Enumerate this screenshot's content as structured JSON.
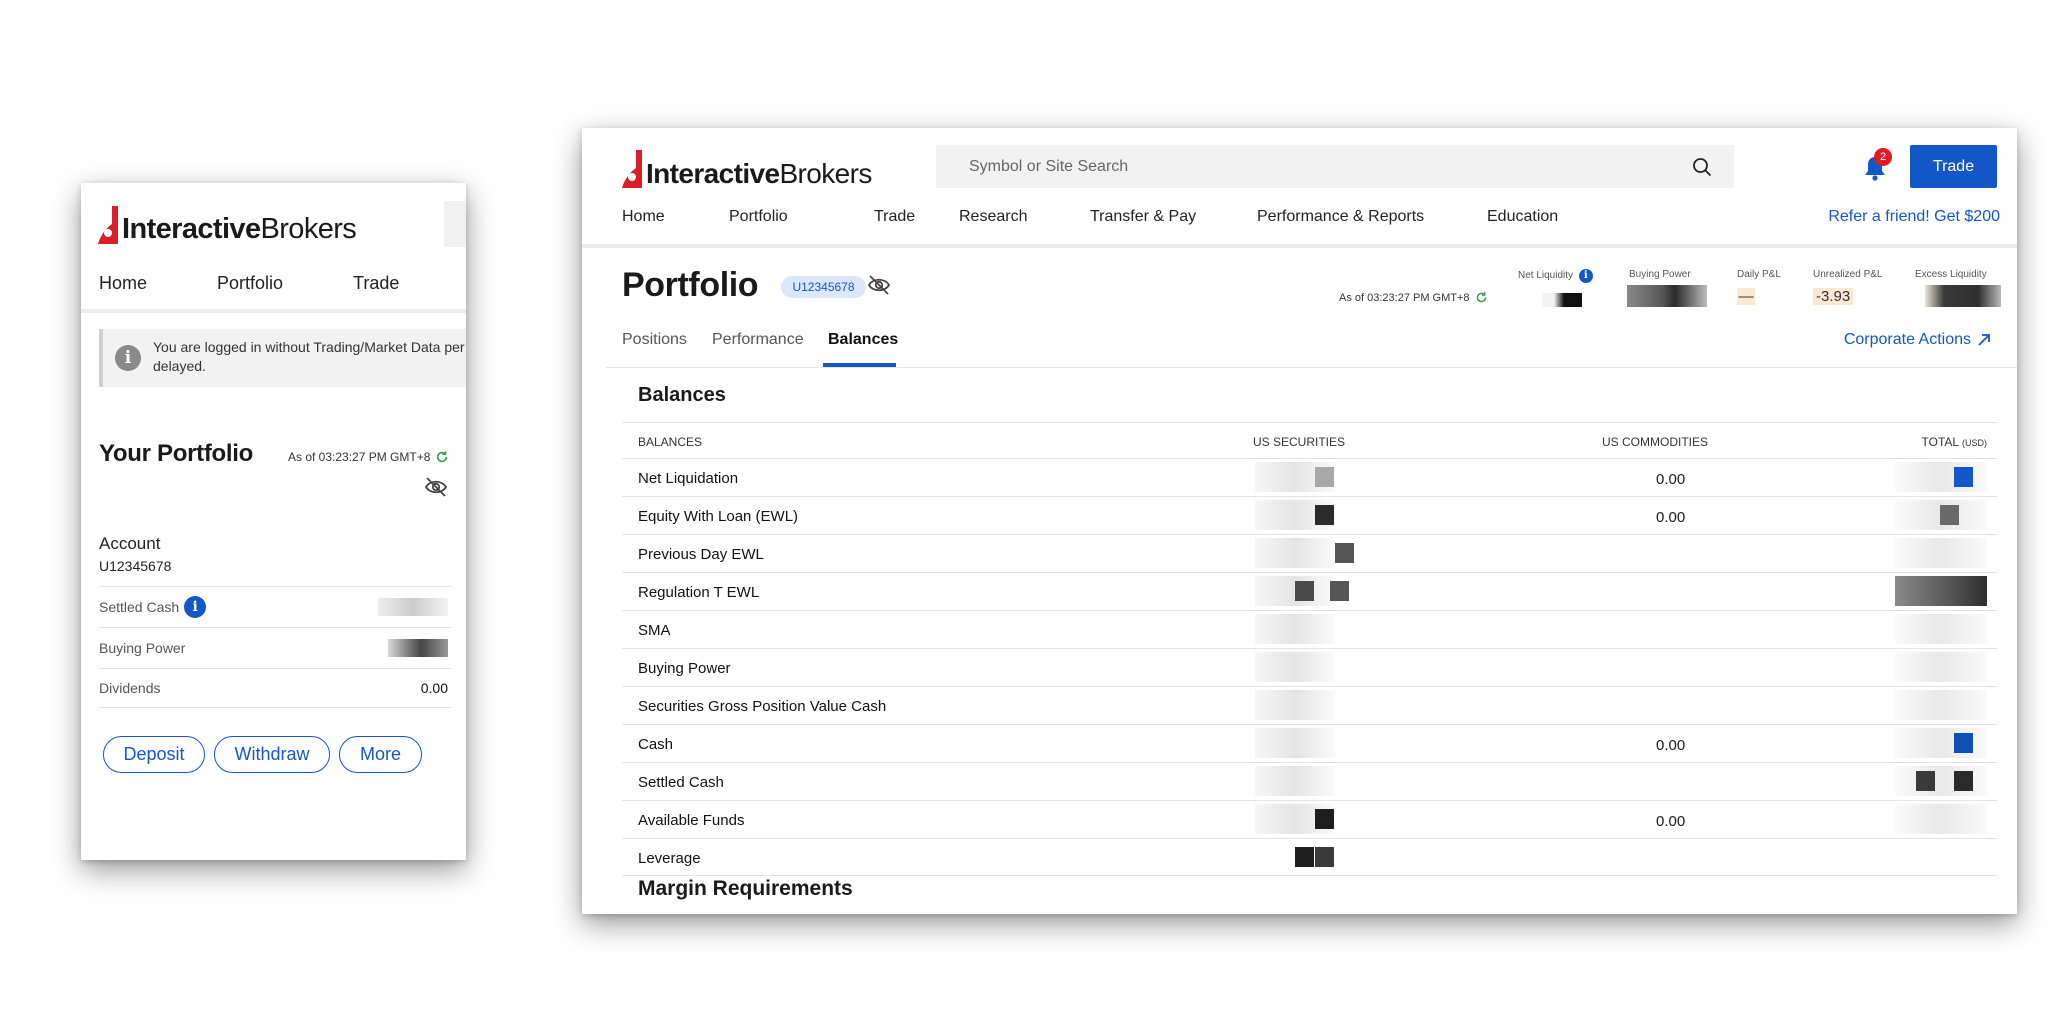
{
  "brand": {
    "bold": "Interactive",
    "regular": "Brokers",
    "color": "#d81e27"
  },
  "accent": "#1457c8",
  "mobile": {
    "nav": [
      "Home",
      "Portfolio",
      "Trade"
    ],
    "notice": "You are logged in without Trading/Market Data per… delayed.",
    "notice_line1": "You are logged in without Trading/Market Data per",
    "notice_line2": "delayed.",
    "title": "Your Portfolio",
    "as_of": "As of 03:23:27 PM GMT+8",
    "account_label": "Account",
    "account_id": "U12345678",
    "rows": [
      {
        "label": "Settled Cash",
        "value": ""
      },
      {
        "label": "Buying Power",
        "value": ""
      },
      {
        "label": "Dividends",
        "value": "0.00"
      }
    ],
    "buttons": [
      "Deposit",
      "Withdraw",
      "More"
    ]
  },
  "desktop": {
    "search_placeholder": "Symbol or Site Search",
    "notification_count": "2",
    "trade_label": "Trade",
    "nav": [
      "Home",
      "Portfolio",
      "Trade",
      "Research",
      "Transfer & Pay",
      "Performance & Reports",
      "Education"
    ],
    "refer": "Refer a friend! Get $200",
    "title": "Portfolio",
    "account_id": "U12345678",
    "as_of": "As of 03:23:27 PM GMT+8",
    "metrics": {
      "net_liquidity": "Net Liquidity",
      "buying_power": "Buying Power",
      "daily_pnl": "Daily P&L",
      "daily_pnl_value": "—",
      "unrealized_pnl": "Unrealized P&L",
      "unrealized_pnl_value": "-3.93",
      "excess_liquidity": "Excess Liquidity"
    },
    "tabs": [
      "Positions",
      "Performance",
      "Balances"
    ],
    "active_tab": "Balances",
    "corporate_actions": "Corporate Actions",
    "balances_title": "Balances",
    "columns": {
      "balances": "BALANCES",
      "us_securities": "US SECURITIES",
      "us_commodities": "US COMMODITIES",
      "total": "TOTAL",
      "total_unit": "(USD)"
    },
    "rows": [
      {
        "label": "Net Liquidation",
        "commodities": "0.00"
      },
      {
        "label": "Equity With Loan (EWL)",
        "commodities": "0.00"
      },
      {
        "label": "Previous Day EWL",
        "commodities": ""
      },
      {
        "label": "Regulation T EWL",
        "commodities": ""
      },
      {
        "label": "SMA",
        "commodities": ""
      },
      {
        "label": "Buying Power",
        "commodities": ""
      },
      {
        "label": "Securities Gross Position Value Cash",
        "commodities": ""
      },
      {
        "label": "Cash",
        "commodities": "0.00"
      },
      {
        "label": "Settled Cash",
        "commodities": ""
      },
      {
        "label": "Available Funds",
        "commodities": "0.00"
      },
      {
        "label": "Leverage",
        "commodities": ""
      }
    ],
    "margin_title": "Margin Requirements"
  }
}
